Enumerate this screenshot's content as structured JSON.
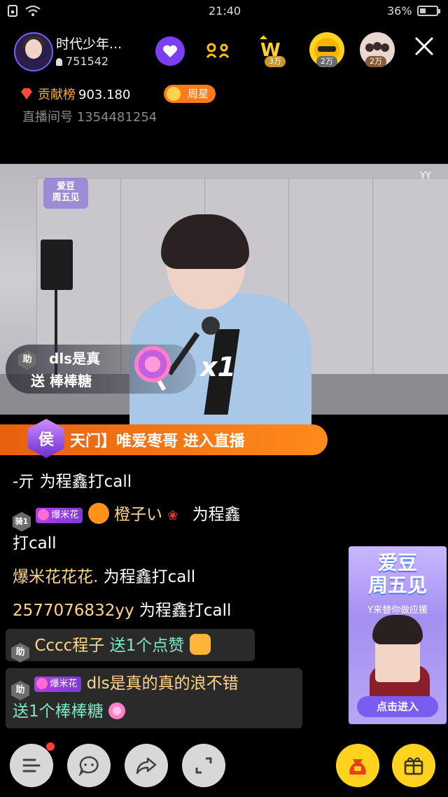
{
  "status_bar": {
    "time": "21:40",
    "battery_pct": "36%"
  },
  "header": {
    "host_name": "时代少年...",
    "viewer_count": "751542",
    "rank_badges": [
      "3万",
      "2万",
      "2万"
    ],
    "contrib_label": "贡献榜",
    "contrib_value": "903.180",
    "weekly_star": "周星",
    "room_label": "直播间号",
    "room_no": "1354481254"
  },
  "video": {
    "logo_text": "爱豆\n周五见",
    "yy_mark": "YY",
    "gift_user": "dls是真",
    "gift_action": "送 棒棒糖",
    "gift_combo": "x1"
  },
  "entry": {
    "badge": "侯",
    "text": "天门】唯爱枣哥 进入直播"
  },
  "chat": [
    {
      "nick": "-亓",
      "msg": "为程鑫打call"
    },
    {
      "level_badge": "骑1",
      "fan_badge": "爆米花",
      "fan_level": "2",
      "nick": "橙子い",
      "msg": "为程鑫",
      "msg2": "打call"
    },
    {
      "nick": "爆米花花花.",
      "msg": "为程鑫打call"
    },
    {
      "nick": "2577076832yy",
      "msg": "为程鑫打call"
    },
    {
      "badge": "助",
      "nick": "Cccc程子",
      "msg": "送1个点赞"
    },
    {
      "badge": "助",
      "fan_badge": "爆米花",
      "nick": "dls是真的真的浪不错",
      "msg": "送1个棒棒糖"
    }
  ],
  "ad": {
    "title": "爱豆\n周五见",
    "subtitle": "Y来替你做应援",
    "button": "点击进入"
  },
  "bottom_bar": [
    "menu-button",
    "chat-button",
    "share-button",
    "fullscreen-button",
    "lucky-bag-button",
    "gift-button"
  ]
}
